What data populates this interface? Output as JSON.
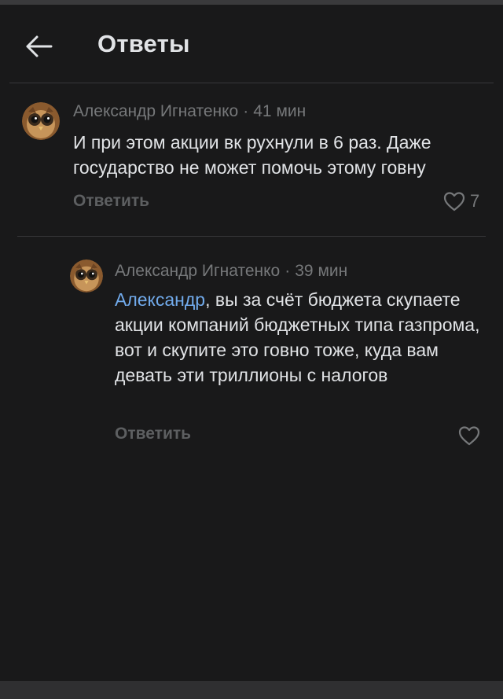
{
  "header": {
    "title": "Ответы"
  },
  "comments": [
    {
      "author": "Александр Игнатенко",
      "time": "41 мин",
      "text": "И при этом акции вк рухнули в 6 раз. Даже государство не может помочь этому говну",
      "reply_label": "Ответить",
      "likes": "7"
    },
    {
      "author": "Александр Игнатенко",
      "time": "39 мин",
      "mention": "Александр",
      "text": ", вы за счёт бюджета скупаете акции компаний бюджетных типа газпрома, вот и скупите это говно тоже, куда вам девать эти триллионы с налогов",
      "reply_label": "Ответить"
    }
  ],
  "icons": {
    "back": "arrow-left-icon",
    "like": "heart-outline-icon",
    "avatar": "owl-avatar"
  },
  "colors": {
    "background": "#19191a",
    "text": "#e1e3e6",
    "secondary": "#76787a",
    "mention": "#71aaeb"
  }
}
